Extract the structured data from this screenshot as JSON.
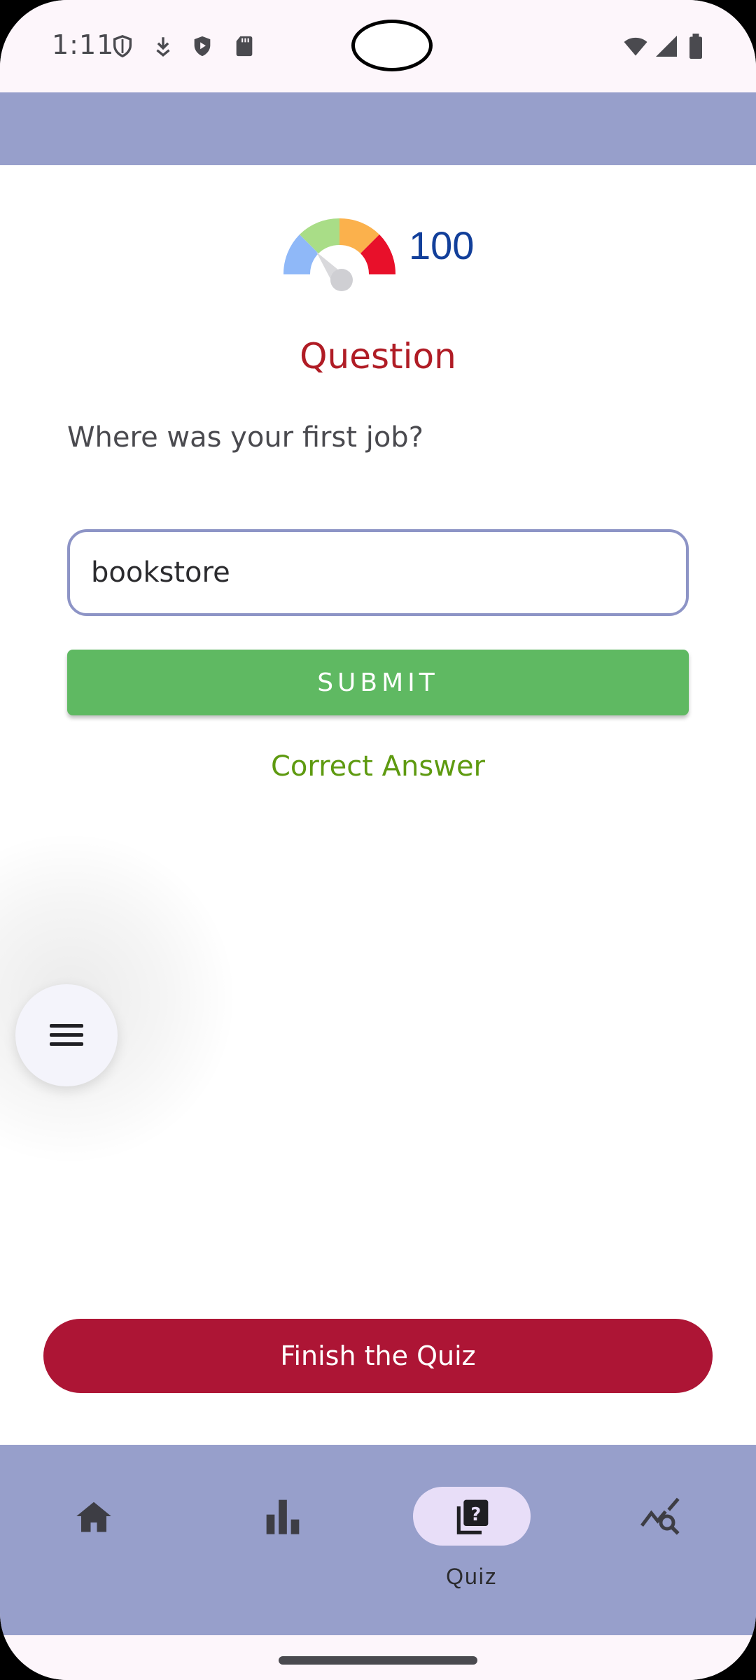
{
  "status_bar": {
    "time": "1:11",
    "left_icons": [
      "shield-outline-icon",
      "download-icon",
      "play-protect-icon",
      "sd-card-icon"
    ],
    "right_icons": [
      "wifi-icon",
      "cellular-signal-icon",
      "battery-icon"
    ]
  },
  "score": {
    "value": "100",
    "gauge_colors": [
      "#8fb8f8",
      "#a9dd87",
      "#fbb14c",
      "#e8102a"
    ]
  },
  "question": {
    "title": "Question",
    "text": "Where was your first job?"
  },
  "answer": {
    "value": "bookstore"
  },
  "submit": {
    "label": "SUBMIT"
  },
  "feedback": {
    "text": "Correct Answer"
  },
  "menu_fab": {
    "icon": "menu-icon"
  },
  "finish": {
    "label": "Finish the Quiz"
  },
  "bottom_nav": {
    "items": [
      {
        "icon": "home-icon",
        "label": ""
      },
      {
        "icon": "bar-chart-icon",
        "label": ""
      },
      {
        "icon": "quiz-icon",
        "label": "Quiz",
        "active": true
      },
      {
        "icon": "query-stats-icon",
        "label": ""
      }
    ]
  },
  "colors": {
    "app_bar": "#979fcb",
    "question_title": "#b01c25",
    "score": "#123f9a",
    "submit": "#5fb962",
    "feedback": "#5e9a10",
    "finish": "#ad1535",
    "nav_active_pill": "#e8def8"
  }
}
